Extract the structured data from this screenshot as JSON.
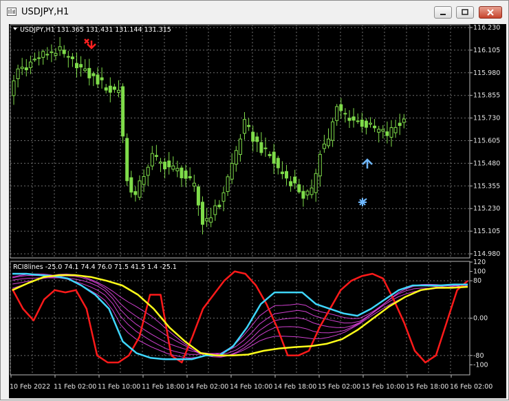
{
  "window": {
    "title": "USDJPY,H1"
  },
  "main_chart": {
    "header": "USDJPY,H1  131.365 131.431 131.144 131.315",
    "y_axis_labels": [
      "116.230",
      "116.105",
      "115.980",
      "115.855",
      "115.730",
      "115.605",
      "115.480",
      "115.355",
      "115.230",
      "115.105",
      "114.980"
    ],
    "candle_color": "#7fdc4a",
    "sell_arrow_color": "#ff2020",
    "buy_arrow_color": "#6fb8ff"
  },
  "indicator": {
    "header": "RCI8lines -25.0 74.1 74.4 76.0 71.5 41.5 1.4 -25.1",
    "y_axis_labels": [
      "120",
      "100",
      "80",
      "0.00",
      "-80",
      "-100"
    ],
    "colors": {
      "red": "#ff1a1a",
      "cyan": "#3fd7ff",
      "yellow": "#ffff1a",
      "magenta": "#d040d0"
    }
  },
  "x_axis_labels": [
    "10 Feb 2022",
    "11 Feb 02:00",
    "11 Feb 10:00",
    "11 Feb 18:00",
    "14 Feb 02:00",
    "14 Feb 10:00",
    "14 Feb 18:00",
    "15 Feb 02:00",
    "15 Feb 10:00",
    "15 Feb 18:00",
    "16 Feb 02:00"
  ],
  "chart_data": [
    {
      "type": "line",
      "title": "USDJPY,H1",
      "series": [
        {
          "name": "USDJPY,H1",
          "values": [
            115.87,
            116.0,
            116.02,
            116.05,
            116.08,
            116.1,
            116.1,
            116.05,
            116.03,
            115.98,
            115.95,
            115.92,
            115.88,
            115.89,
            115.38,
            115.3,
            115.42,
            115.52,
            115.48,
            115.46,
            115.44,
            115.4,
            115.35,
            115.15,
            115.2,
            115.25,
            115.4,
            115.55,
            115.7,
            115.62,
            115.56,
            115.52,
            115.45,
            115.4,
            115.36,
            115.3,
            115.32,
            115.55,
            115.62,
            115.78,
            115.75,
            115.72,
            115.7,
            115.68,
            115.66,
            115.64,
            115.68,
            115.72
          ]
        }
      ],
      "ylim": [
        114.98,
        116.23
      ]
    },
    {
      "type": "line",
      "title": "RCI8lines",
      "series": [
        {
          "name": "red",
          "values": [
            62,
            20,
            -5,
            40,
            60,
            55,
            60,
            20,
            -80,
            -95,
            -95,
            -80,
            -40,
            50,
            50,
            -80,
            -95,
            -40,
            20,
            50,
            80,
            100,
            95,
            70,
            30,
            -20,
            -80,
            -80,
            -70,
            -20,
            20,
            60,
            80,
            90,
            95,
            85,
            40,
            -10,
            -70,
            -95,
            -80,
            -10,
            60,
            80
          ]
        },
        {
          "name": "cyan",
          "values": [
            95,
            95,
            92,
            90,
            85,
            70,
            50,
            20,
            -50,
            -75,
            -85,
            -88,
            -88,
            -88,
            -80,
            -80,
            -60,
            -20,
            30,
            55,
            55,
            55,
            30,
            20,
            10,
            5,
            20,
            40,
            60,
            70,
            70,
            70,
            72,
            72
          ]
        },
        {
          "name": "yellow",
          "values": [
            60,
            75,
            88,
            92,
            92,
            88,
            80,
            70,
            50,
            20,
            -20,
            -50,
            -75,
            -80,
            -80,
            -78,
            -70,
            -65,
            -62,
            -60,
            -55,
            -45,
            -25,
            0,
            25,
            45,
            60,
            65,
            65,
            67
          ]
        }
      ],
      "ylim": [
        -120,
        120
      ]
    }
  ]
}
